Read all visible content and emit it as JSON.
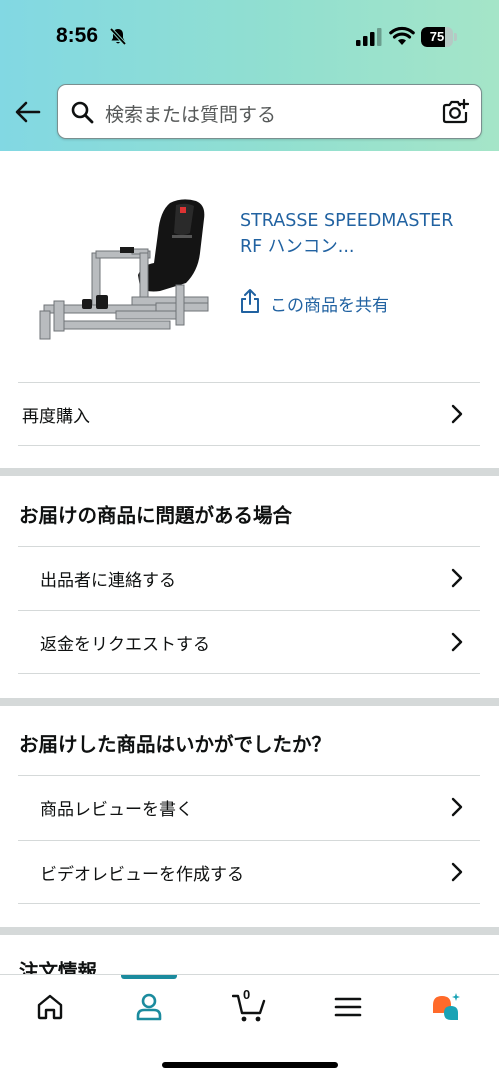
{
  "status_bar": {
    "time": "8:56",
    "battery": "75",
    "battery_level": 0.75
  },
  "search": {
    "placeholder": "検索または質問する"
  },
  "product": {
    "title": "STRASSE SPEEDMASTER RF ハンコン...",
    "share_label": "この商品を共有"
  },
  "rebuy": {
    "label": "再度購入"
  },
  "problem_section": {
    "title": "お届けの商品に問題がある場合",
    "items": [
      {
        "label": "出品者に連絡する"
      },
      {
        "label": "返金をリクエストする"
      }
    ]
  },
  "feedback_section": {
    "title": "お届けした商品はいかがでしたか？",
    "items": [
      {
        "label": "商品レビューを書く"
      },
      {
        "label": "ビデオレビューを作成する"
      }
    ]
  },
  "order_info": {
    "title": "注文情報"
  },
  "bottom_nav": {
    "active": "account",
    "cart_count": "0",
    "items": [
      "home",
      "account",
      "cart",
      "menu",
      "rufus"
    ]
  },
  "colors": {
    "header_gradient_start": "#82d8e3",
    "header_gradient_end": "#a5e5c8",
    "link": "#2162a1",
    "active_tab": "#1b8b9e",
    "rufus_orange": "#ff6a2a",
    "rufus_teal": "#1aa3b5"
  },
  "icons": {
    "back": "back-arrow-icon",
    "search": "search-icon",
    "camera": "camera-icon",
    "share": "share-icon",
    "chevron": "chevron-right-icon"
  }
}
